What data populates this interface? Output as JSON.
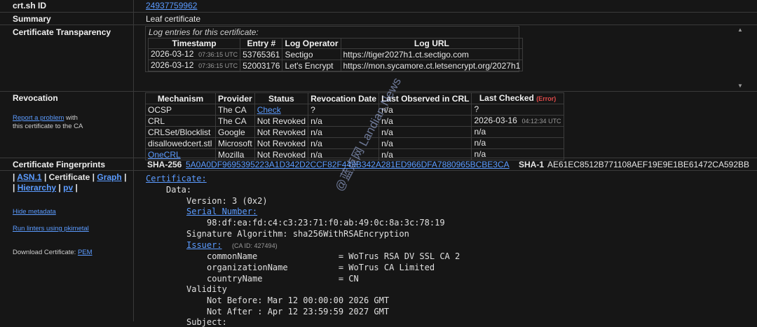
{
  "rows": {
    "crtsh_id": {
      "label": "crt.sh ID",
      "value": "24937759962"
    },
    "summary": {
      "label": "Summary",
      "value": "Leaf certificate"
    },
    "ct": {
      "label": "Certificate Transparency",
      "caption": "Log entries for this certificate:",
      "headers": [
        "Timestamp",
        "Entry #",
        "Log Operator",
        "Log URL"
      ],
      "entries": [
        {
          "date": "2026-03-12",
          "time": "07:36:15 UTC",
          "entry": "53765361",
          "operator": "Sectigo",
          "url": "https://tiger2027h1.ct.sectigo.com"
        },
        {
          "date": "2026-03-12",
          "time": "07:36:15 UTC",
          "entry": "52003176",
          "operator": "Let's Encrypt",
          "url": "https://mon.sycamore.ct.letsencrypt.org/2027h1"
        }
      ]
    },
    "revocation": {
      "label": "Revocation",
      "report_link": "Report a problem",
      "report_text1": " with",
      "report_text2": "this certificate to the CA",
      "headers": [
        "Mechanism",
        "Provider",
        "Status",
        "Revocation Date",
        "Last Observed in CRL",
        "Last Checked"
      ],
      "last_checked_note": "(Error)",
      "rows": [
        {
          "mechanism": "OCSP",
          "provider": "The CA",
          "status": "Check",
          "rev_date": "?",
          "last_obs": "n/a",
          "last_checked": "?",
          "lc_time": ""
        },
        {
          "mechanism": "CRL",
          "provider": "The CA",
          "status": "Not Revoked",
          "rev_date": "n/a",
          "last_obs": "n/a",
          "last_checked": "2026-03-16",
          "lc_time": "04:12:34 UTC"
        },
        {
          "mechanism": "CRLSet/Blocklist",
          "provider": "Google",
          "status": "Not Revoked",
          "rev_date": "n/a",
          "last_obs": "n/a",
          "last_checked": "n/a",
          "lc_time": ""
        },
        {
          "mechanism": "disallowedcert.stl",
          "provider": "Microsoft",
          "status": "Not Revoked",
          "rev_date": "n/a",
          "last_obs": "n/a",
          "last_checked": "n/a",
          "lc_time": ""
        },
        {
          "mechanism": "OneCRL",
          "provider": "Mozilla",
          "status": "Not Revoked",
          "rev_date": "n/a",
          "last_obs": "n/a",
          "last_checked": "n/a",
          "lc_time": ""
        }
      ]
    },
    "fingerprints": {
      "label": "Certificate Fingerprints",
      "sha256_label": "SHA-256",
      "sha256": "5A0A0DF9695395223A1D342D2CCF82F449B342A281ED966DFA7880965BCBE3CA",
      "sha1_label": "SHA-1",
      "sha1": "AE61EC8512B771108AEF19E9E1BE61472CA592BB"
    },
    "viewer": {
      "nav_pipe": "|",
      "nav_asn1": "ASN.1",
      "nav_certificate": "Certificate",
      "nav_graph": "Graph",
      "nav_hierarchy": "Hierarchy",
      "nav_pv": "pv",
      "hide_metadata": "Hide metadata",
      "run_linters": "Run linters using pkimetal",
      "download_text": "Download Certificate: ",
      "download_link": "PEM"
    }
  },
  "cert": {
    "certificate": "Certificate:",
    "data": "Data:",
    "version": "Version: 3 (0x2)",
    "serial_label": "Serial Number:",
    "serial": "98:df:ea:fd:c4:c3:23:71:f0:ab:49:0c:8a:3c:78:19",
    "sig_alg": "Signature Algorithm: sha256WithRSAEncryption",
    "issuer_label": "Issuer:",
    "ca_id": "(CA ID: 427494)",
    "cn": "commonName                = WoTrus RSA DV SSL CA 2",
    "org": "organizationName          = WoTrus CA Limited",
    "country": "countryName               = CN",
    "validity": "Validity",
    "not_before": "Not Before: Mar 12 00:00:00 2026 GMT",
    "not_after": "Not After : Apr 12 23:59:59 2027 GMT",
    "subject": "Subject:"
  },
  "watermark": "@蓝点网 Landian.News"
}
